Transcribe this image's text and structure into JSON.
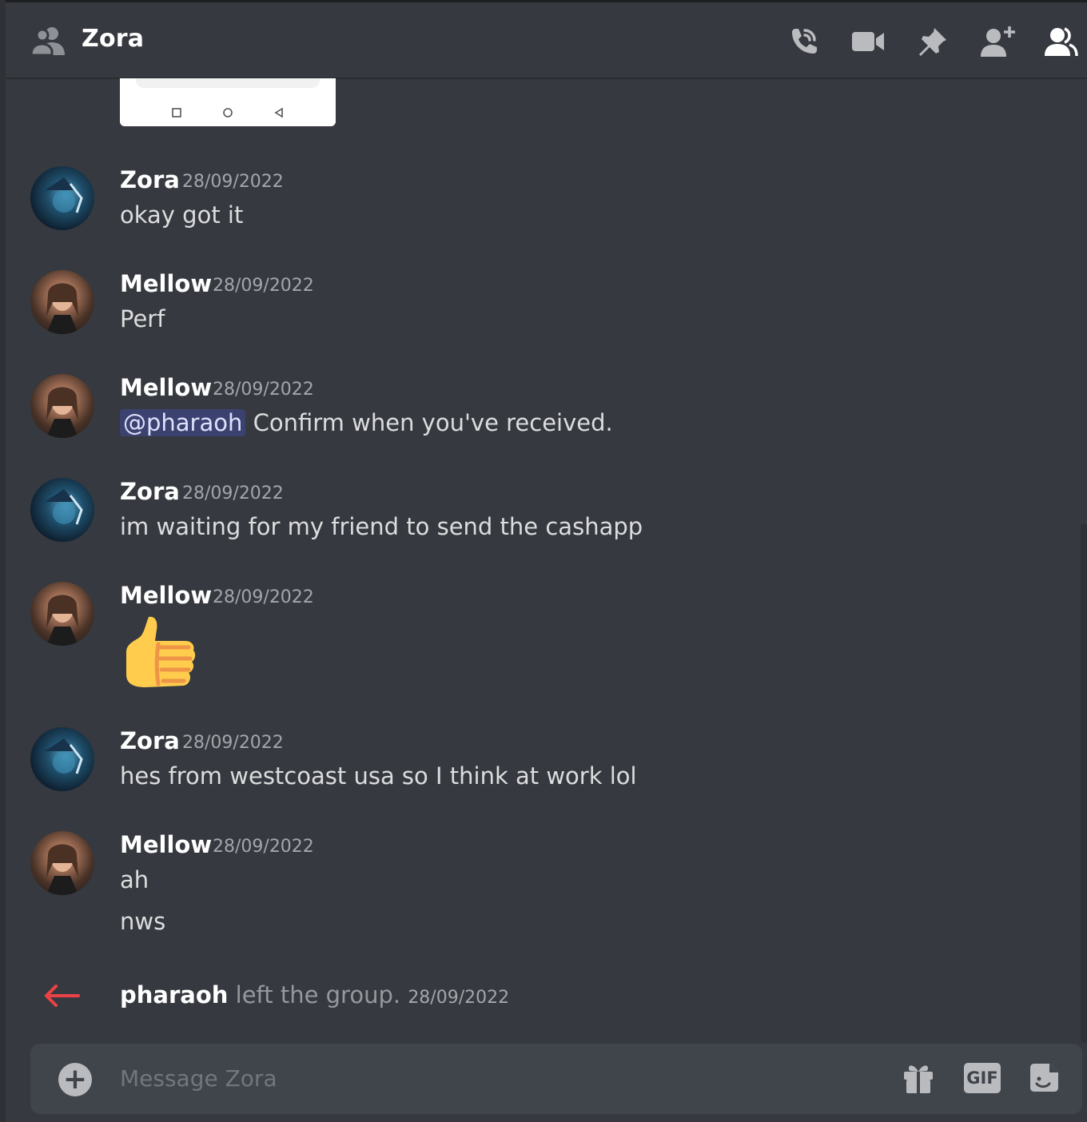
{
  "header": {
    "title": "Zora",
    "icons": [
      "group-dm-icon",
      "voice-call-icon",
      "video-call-icon",
      "pin-icon",
      "add-friend-icon",
      "member-list-icon"
    ]
  },
  "messages": [
    {
      "author": "Zora",
      "timestamp": "28/09/2022",
      "lines": [
        "okay got it"
      ]
    },
    {
      "author": "Mellow",
      "timestamp": "28/09/2022",
      "lines": [
        "Perf"
      ]
    },
    {
      "author": "Mellow",
      "timestamp": "28/09/2022",
      "mention": "@pharaoh",
      "lines": [
        " Confirm when you've received."
      ]
    },
    {
      "author": "Zora",
      "timestamp": "28/09/2022",
      "lines": [
        "im waiting for my friend to send the cashapp"
      ]
    },
    {
      "author": "Mellow",
      "timestamp": "28/09/2022",
      "emoji": "thumbs-up-emoji"
    },
    {
      "author": "Zora",
      "timestamp": "28/09/2022",
      "lines": [
        "hes from westcoast usa so I think at work lol"
      ]
    },
    {
      "author": "Mellow",
      "timestamp": "28/09/2022",
      "lines": [
        "ah",
        "nws"
      ]
    }
  ],
  "system": {
    "user": "pharaoh",
    "action": " left the group. ",
    "timestamp": "28/09/2022"
  },
  "composer": {
    "placeholder": "Message Zora",
    "gif_label": "GIF"
  },
  "colors": {
    "background": "#36393f",
    "composer": "#40444b",
    "mention_bg": "#3c4270",
    "leave_arrow": "#ed4245"
  }
}
